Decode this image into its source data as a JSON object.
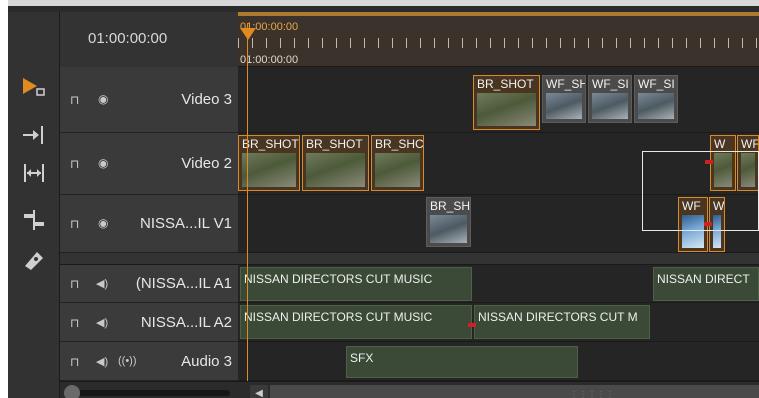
{
  "timecode": "01:00:00:00",
  "ruler": {
    "time_top": "01:00:00:00",
    "time_bottom": "01:00:00:00"
  },
  "tools": [
    {
      "name": "selection-tool-icon",
      "glyph": "▸"
    },
    {
      "name": "ripple-tool-icon",
      "glyph": "→|"
    },
    {
      "name": "trim-tool-icon",
      "glyph": "⟷"
    },
    {
      "name": "slip-tool-icon",
      "glyph": "⇆"
    },
    {
      "name": "razor-tool-icon",
      "glyph": "⧫"
    }
  ],
  "tracks": {
    "video3": {
      "name": "Video 3"
    },
    "video2": {
      "name": "Video 2"
    },
    "video1": {
      "name": "NISSA...IL V1"
    },
    "audio1": {
      "name": "(NISSA...IL A1"
    },
    "audio2": {
      "name": "NISSA...IL A2"
    },
    "audio3": {
      "name": "Audio 3"
    }
  },
  "clips": {
    "v3_c1": "BR_SHOT",
    "v3_c2": "WF_SH",
    "v3_c3": "WF_SI",
    "v3_c4": "WF_SI",
    "v2_c1": "BR_SHOT",
    "v2_c2": "BR_SHOT",
    "v2_c3": "BR_SHC",
    "v2_c4": "W",
    "v2_c5": "WF",
    "v1_c1": "BR_SH",
    "v1_c2": "WF",
    "v1_c3": "W",
    "a1_c1": "NISSAN DIRECTORS CUT MUSIC",
    "a1_c2": "NISSAN DIRECT",
    "a2_c1": "NISSAN DIRECTORS CUT MUSIC",
    "a2_c2": "NISSAN DIRECTORS CUT M",
    "a3_c1": "SFX"
  },
  "icons": {
    "lock": "🔓",
    "eye": "◉",
    "speaker": "◀)",
    "waveform": "((•))"
  },
  "colors": {
    "accent": "#e08a20",
    "video_clip_border": "#d98a2b",
    "audio_clip": "#3a4a36"
  }
}
